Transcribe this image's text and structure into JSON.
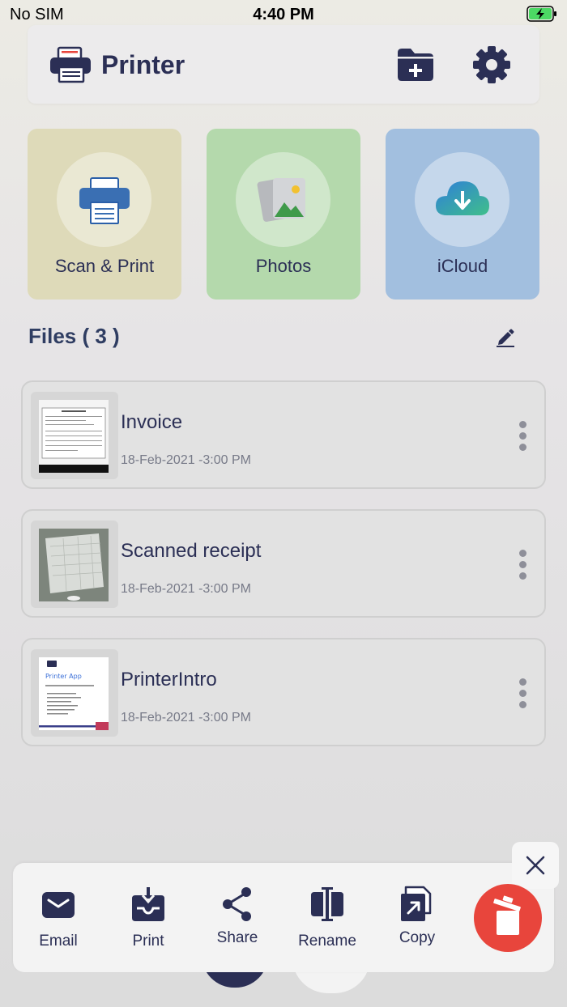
{
  "status_bar": {
    "carrier": "No SIM",
    "time": "4:40 PM"
  },
  "header": {
    "title": "Printer",
    "icons": [
      "printer-logo-icon",
      "add-folder-icon",
      "gear-icon"
    ]
  },
  "sources": [
    {
      "label": "Scan & Print",
      "icon": "printer-icon",
      "color": "#dedab9"
    },
    {
      "label": "Photos",
      "icon": "photos-icon",
      "color": "#b4d9ac"
    },
    {
      "label": "iCloud",
      "icon": "cloud-download-icon",
      "color": "#a2bfdf"
    }
  ],
  "files": {
    "title": "Files ( 3 )",
    "items": [
      {
        "name": "Invoice",
        "date": "18-Feb-2021 -3:00 PM"
      },
      {
        "name": "Scanned receipt",
        "date": "18-Feb-2021 -3:00 PM"
      },
      {
        "name": "PrinterIntro",
        "date": "18-Feb-2021 -3:00 PM"
      }
    ]
  },
  "thumbnails": {
    "printer_intro_title": "Printer App"
  },
  "actions": [
    {
      "label": "Email",
      "icon": "mail-icon"
    },
    {
      "label": "Print",
      "icon": "print-tray-icon"
    },
    {
      "label": "Share",
      "icon": "share-icon"
    },
    {
      "label": "Rename",
      "icon": "rename-icon"
    },
    {
      "label": "Copy",
      "icon": "copy-icon"
    }
  ],
  "colors": {
    "primary": "#2b2f55",
    "delete": "#e8453c",
    "cloud_blue": "#2f7fd9",
    "cloud_green": "#3fbf8a"
  }
}
